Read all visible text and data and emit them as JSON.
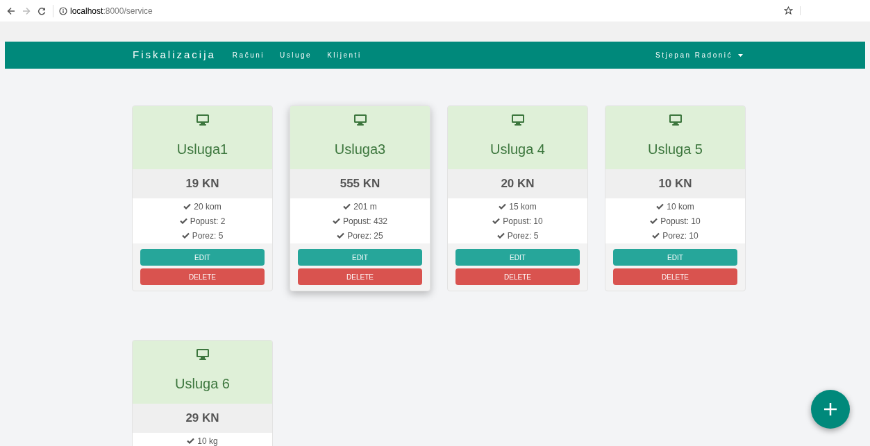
{
  "browser": {
    "url_host": "localhost",
    "url_path": ":8000/service"
  },
  "navbar": {
    "brand": "Fiskalizacija",
    "links": [
      "Računi",
      "Usluge",
      "Klijenti"
    ],
    "user": "Stjepan Radonić"
  },
  "services": [
    {
      "name": "Usluga1",
      "price": "19 KN",
      "details": [
        "20 kom",
        "Popust: 2",
        "Porez: 5"
      ],
      "raised": false,
      "buttons": [
        "EDIT",
        "DELETE"
      ]
    },
    {
      "name": "Usluga3",
      "price": "555 KN",
      "details": [
        "201 m",
        "Popust: 432",
        "Porez: 25"
      ],
      "raised": true,
      "buttons": [
        "EDIT",
        "DELETE"
      ]
    },
    {
      "name": "Usluga 4",
      "price": "20 KN",
      "details": [
        "15 kom",
        "Popust: 10",
        "Porez: 5"
      ],
      "raised": false,
      "buttons": [
        "EDIT",
        "DELETE"
      ]
    },
    {
      "name": "Usluga 5",
      "price": "10 KN",
      "details": [
        "10 kom",
        "Popust: 10",
        "Porez: 10"
      ],
      "raised": false,
      "buttons": [
        "EDIT",
        "DELETE"
      ]
    },
    {
      "name": "Usluga 6",
      "price": "29 KN",
      "details": [
        "10 kg"
      ],
      "raised": false
    }
  ]
}
